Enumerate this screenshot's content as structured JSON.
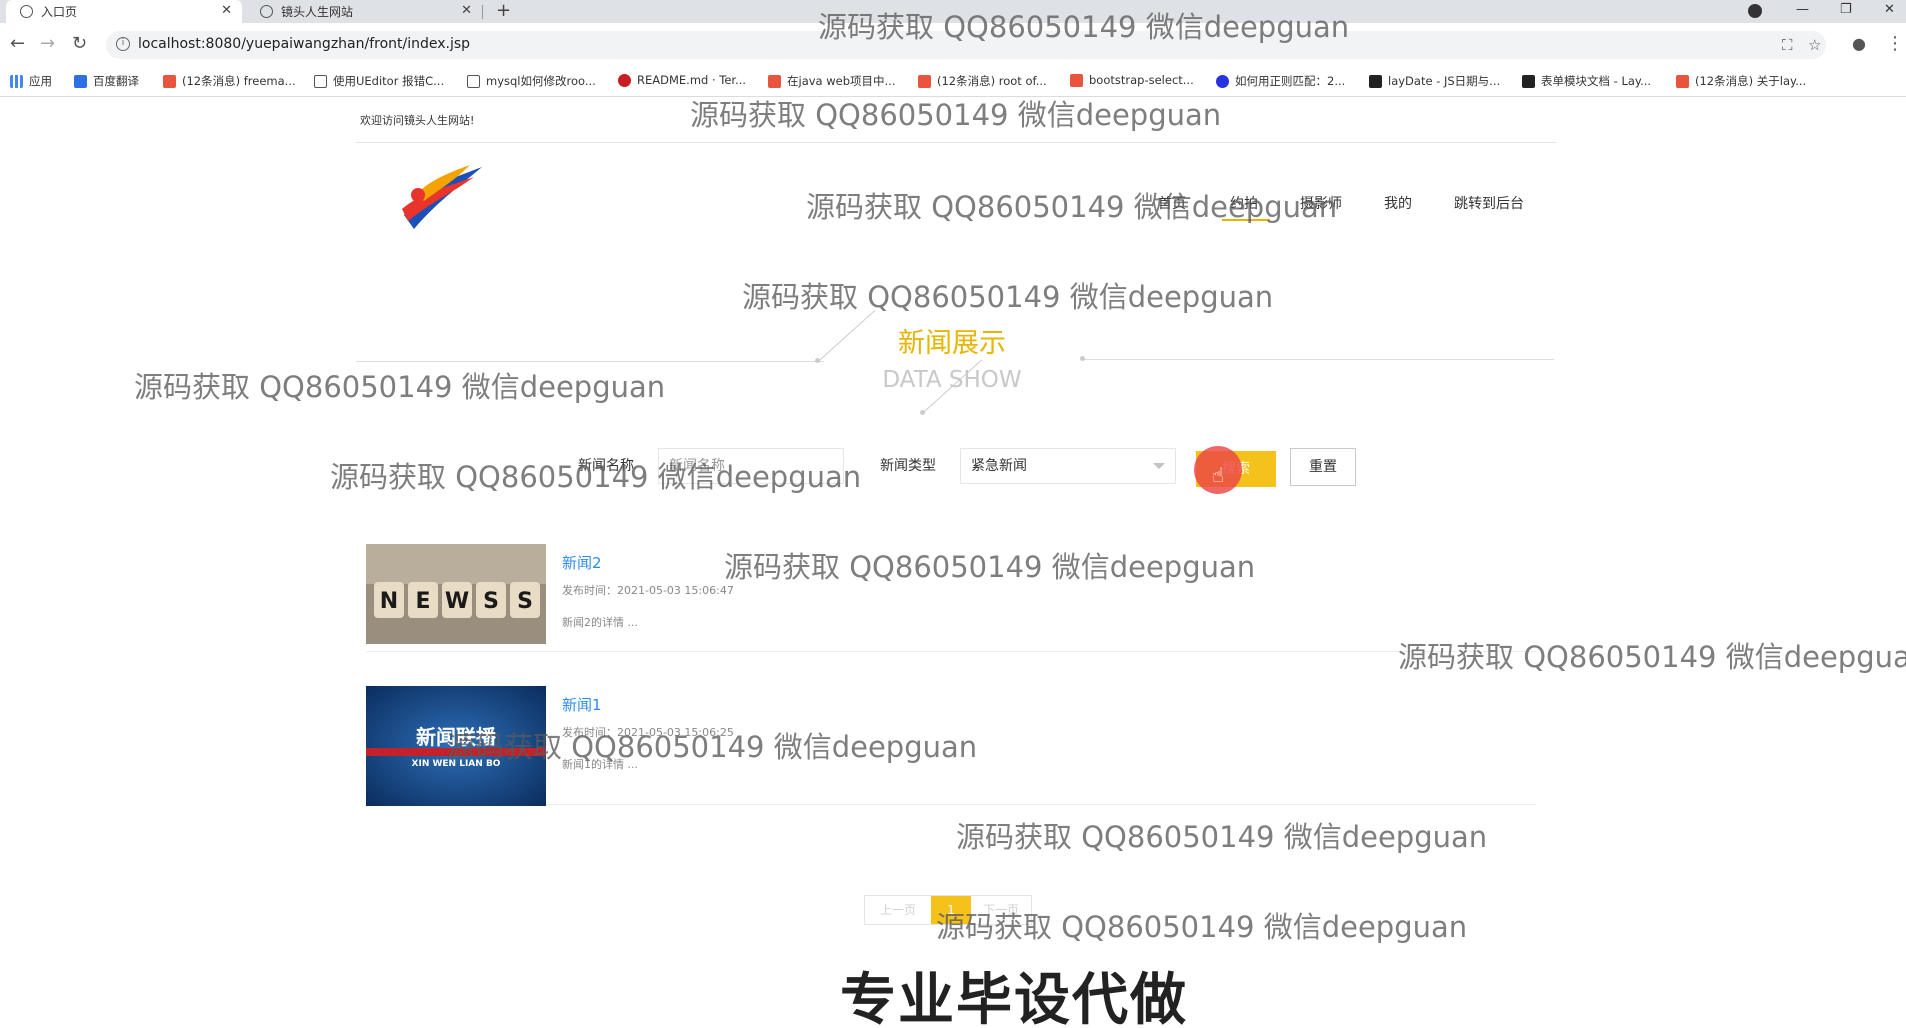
{
  "browser": {
    "tabs": [
      {
        "title": "入口页",
        "active": true
      },
      {
        "title": "镜头人生网站",
        "active": false
      }
    ],
    "new_tab": "+",
    "url": "localhost:8080/yuepaiwangzhan/front/index.jsp",
    "bookmarks": [
      {
        "label": "应用",
        "icon": "apps-grid-icon",
        "color": "#4285f4"
      },
      {
        "label": "百度翻译",
        "icon": "baidu-translate-icon",
        "color": "#2f6fe4"
      },
      {
        "label": "(12条消息) freema...",
        "icon": "csdn-icon",
        "color": "#e8543e"
      },
      {
        "label": "使用UEditor 报错C...",
        "icon": "bookmark-icon",
        "color": "#555555"
      },
      {
        "label": "mysql如何修改roo...",
        "icon": "bookmark-icon",
        "color": "#555555"
      },
      {
        "label": "README.md · Ter...",
        "icon": "gitee-icon",
        "color": "#c71d23"
      },
      {
        "label": "在java web项目中...",
        "icon": "csdn-icon",
        "color": "#e8543e"
      },
      {
        "label": "(12条消息) root of...",
        "icon": "csdn-icon",
        "color": "#e8543e"
      },
      {
        "label": "bootstrap-select...",
        "icon": "bootstrap-icon",
        "color": "#e8543e"
      },
      {
        "label": "如何用正则匹配：2...",
        "icon": "baidu-icon",
        "color": "#2932e1"
      },
      {
        "label": "layDate - JS日期与...",
        "icon": "layui-icon",
        "color": "#222222"
      },
      {
        "label": "表单模块文档 - Lay...",
        "icon": "layui-icon",
        "color": "#222222"
      },
      {
        "label": "(12条消息) 关于lay...",
        "icon": "csdn-icon",
        "color": "#e8543e"
      }
    ]
  },
  "header": {
    "welcome": "欢迎访问镜头人生网站!",
    "nav": [
      "首页",
      "约拍",
      "摄影师",
      "我的",
      "跳转到后台"
    ]
  },
  "section": {
    "title": "新闻展示",
    "subtitle": "DATA SHOW"
  },
  "search": {
    "name_label": "新闻名称",
    "name_placeholder": "新闻名称",
    "type_label": "新闻类型",
    "type_value": "紧急新闻",
    "search_button": "搜索",
    "reset_button": "重置"
  },
  "news": [
    {
      "title": "新闻2",
      "time": "发布时间：2021-05-03 15:06:47",
      "desc": "新闻2的详情 ...",
      "thumb": "news-blocks-image"
    },
    {
      "title": "新闻1",
      "time": "发布时间：2021-05-03 15:06:25",
      "desc": "新闻1的详情 ...",
      "thumb": "xinwen-lianbo-image",
      "thumb_text": "新闻联播",
      "thumb_sub": "XIN WEN LIAN BO"
    }
  ],
  "pager": {
    "prev": "上一页",
    "current": "1",
    "next": "下一页"
  },
  "overlay": {
    "watermark": "源码获取 QQ86050149 微信deepguan",
    "caption": "专业毕设代做"
  },
  "colors": {
    "accent": "#f5c21b",
    "link": "#2d8cf0",
    "click_indicator": "#eb4646"
  }
}
